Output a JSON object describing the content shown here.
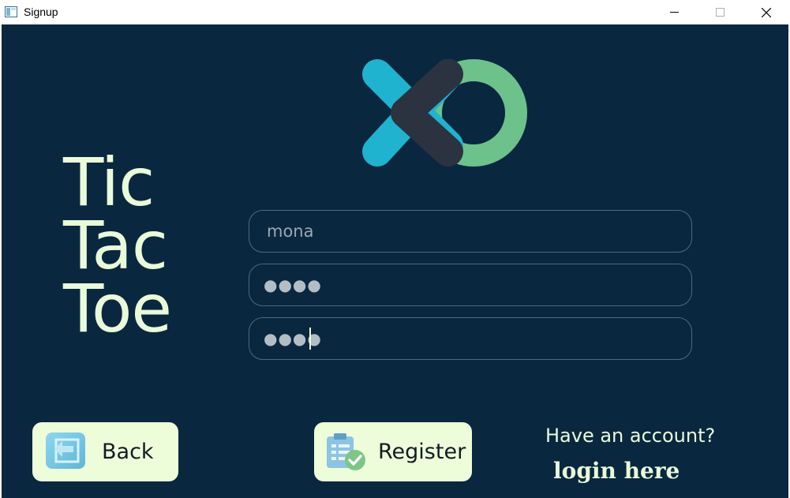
{
  "window": {
    "title": "Signup",
    "controls": {
      "minimize": "minimize",
      "maximize": "maximize",
      "close": "close"
    }
  },
  "app": {
    "title_lines": [
      "Tic",
      "Tac",
      "Toe"
    ],
    "colors": {
      "background": "#0a2740",
      "accent_light": "#e9fbd9",
      "logo_blue": "#1fb3cf",
      "logo_dark": "#2b3340",
      "logo_green": "#6cc28a"
    }
  },
  "form": {
    "username": {
      "value": "mona"
    },
    "password": {
      "masked": "●●●●"
    },
    "confirm_password": {
      "masked": "●●●●"
    }
  },
  "buttons": {
    "back": {
      "label": "Back",
      "icon": "back-arrow-icon"
    },
    "register": {
      "label": "Register",
      "icon": "clipboard-check-icon"
    }
  },
  "footer": {
    "have_account": "Have an account?",
    "login_link": "login here"
  }
}
